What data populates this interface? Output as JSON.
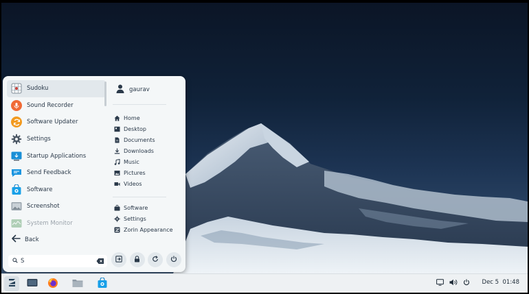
{
  "user": {
    "name": "gaurav"
  },
  "apps": [
    {
      "label": "Sudoku",
      "icon": "sudoku-icon",
      "selected": true
    },
    {
      "label": "Sound Recorder",
      "icon": "sound-recorder-icon"
    },
    {
      "label": "Software Updater",
      "icon": "software-updater-icon"
    },
    {
      "label": "Settings",
      "icon": "settings-gear-icon"
    },
    {
      "label": "Startup Applications",
      "icon": "startup-applications-icon"
    },
    {
      "label": "Send Feedback",
      "icon": "send-feedback-icon"
    },
    {
      "label": "Software",
      "icon": "software-store-icon"
    },
    {
      "label": "Screenshot",
      "icon": "screenshot-icon"
    },
    {
      "label": "System Monitor",
      "icon": "system-monitor-icon",
      "faded": true
    }
  ],
  "back": {
    "label": "Back"
  },
  "search": {
    "value": "S",
    "placeholder": ""
  },
  "places": [
    {
      "label": "Home",
      "icon": "home-icon"
    },
    {
      "label": "Desktop",
      "icon": "desktop-icon"
    },
    {
      "label": "Documents",
      "icon": "documents-icon"
    },
    {
      "label": "Downloads",
      "icon": "downloads-icon"
    },
    {
      "label": "Music",
      "icon": "music-icon"
    },
    {
      "label": "Pictures",
      "icon": "pictures-icon"
    },
    {
      "label": "Videos",
      "icon": "videos-icon"
    }
  ],
  "system_links": [
    {
      "label": "Software",
      "icon": "software-bag-icon"
    },
    {
      "label": "Settings",
      "icon": "settings-icon"
    },
    {
      "label": "Zorin Appearance",
      "icon": "zorin-appearance-icon"
    }
  ],
  "session_actions": [
    {
      "name": "logout-button",
      "icon": "logout-icon"
    },
    {
      "name": "lock-button",
      "icon": "lock-icon"
    },
    {
      "name": "restart-button",
      "icon": "restart-icon"
    },
    {
      "name": "power-button",
      "icon": "power-icon"
    }
  ],
  "taskbar": {
    "items": [
      "zorin-menu-icon",
      "files-window-icon",
      "firefox-icon",
      "file-manager-icon",
      "software-store-icon"
    ],
    "tray": [
      "display-icon",
      "volume-icon",
      "power-icon"
    ],
    "date": "Dec 5",
    "time": "01:48"
  },
  "colors": {
    "accent": "#15a6f0",
    "menu_bg": "#f4f7f8",
    "selected_bg": "#e2e8ec",
    "text": "#2b3a4a"
  }
}
